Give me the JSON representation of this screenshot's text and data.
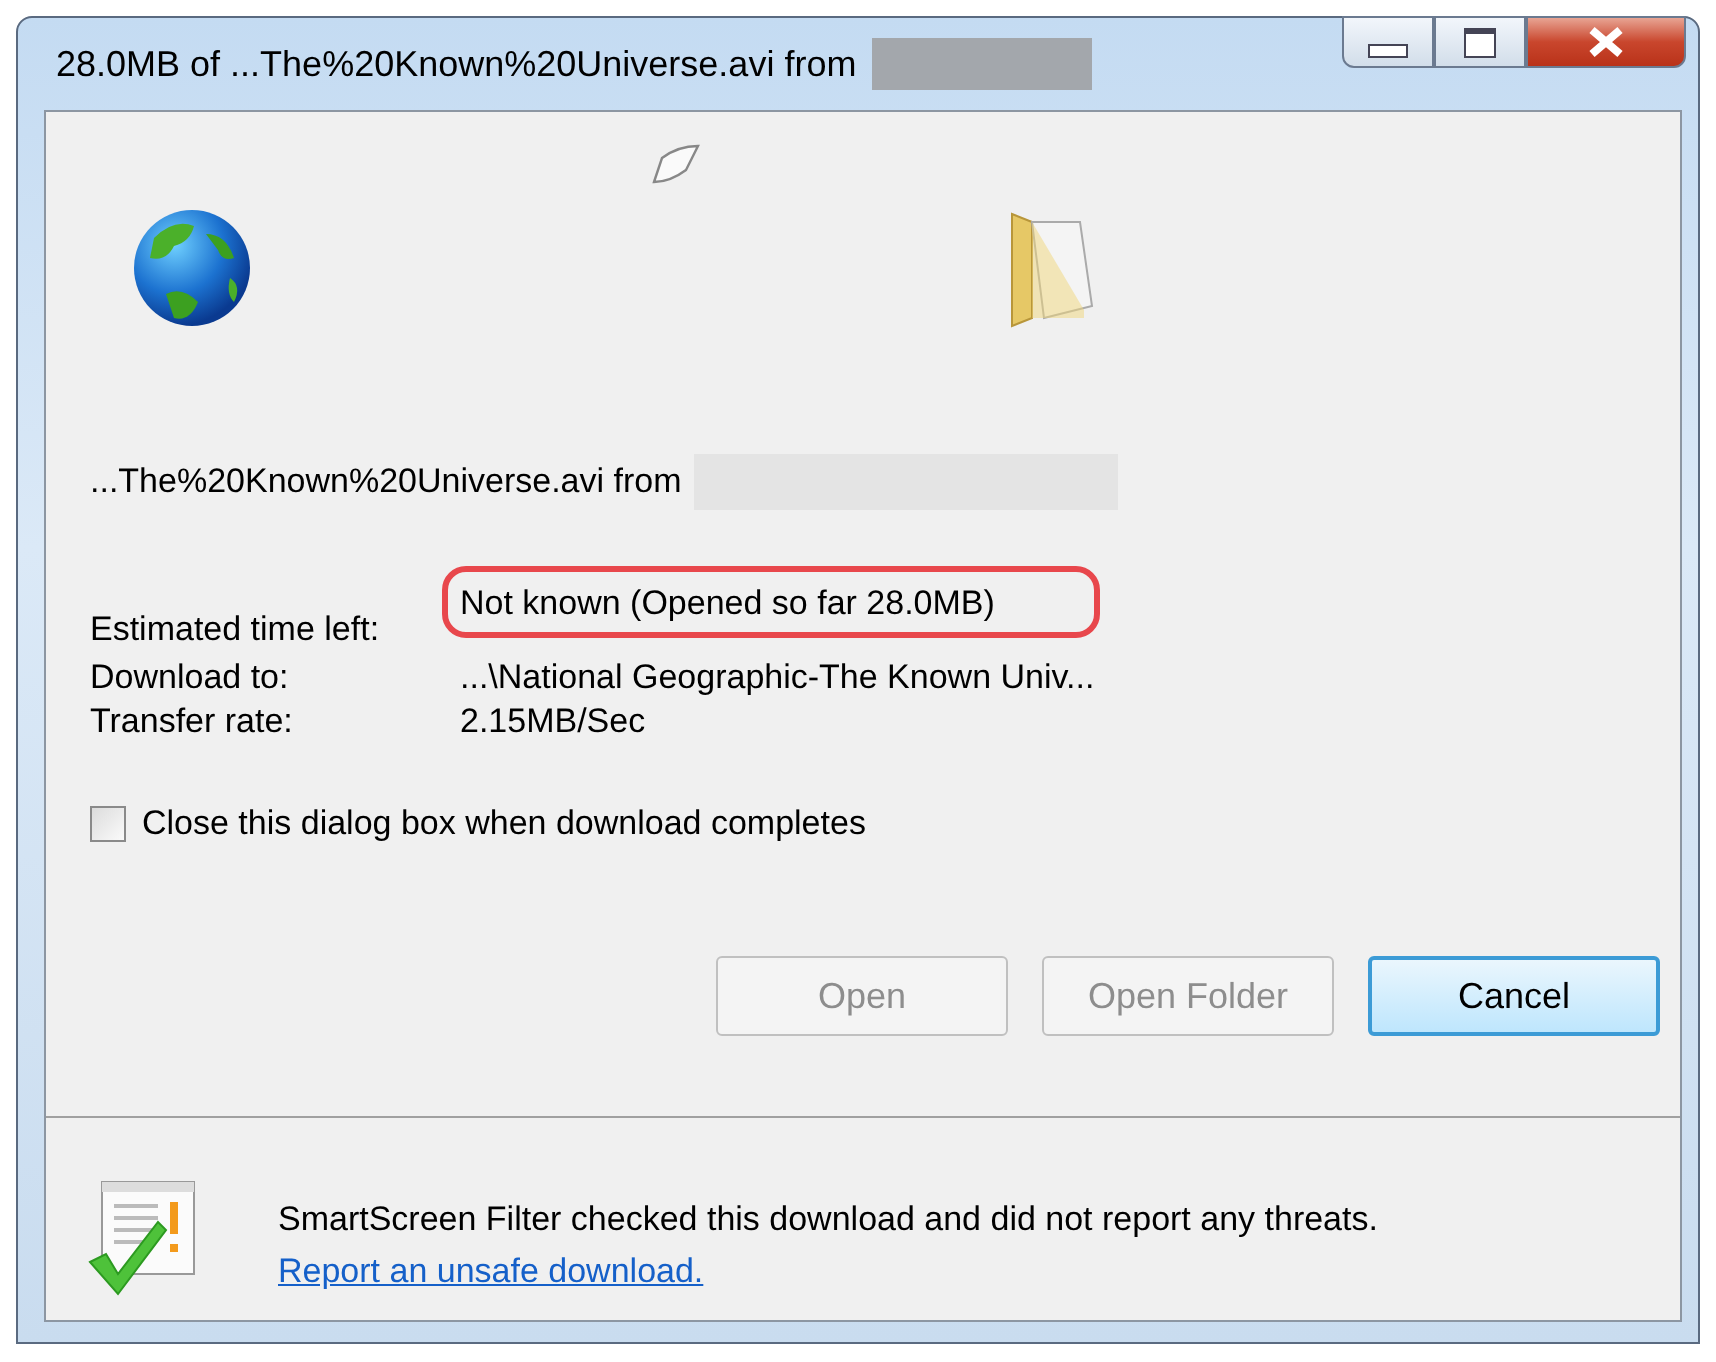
{
  "window": {
    "title": "28.0MB of ...The%20Known%20Universe.avi from"
  },
  "file_line": "...The%20Known%20Universe.avi from",
  "details": [
    {
      "label": "Estimated time left:",
      "value": "Not known (Opened so far 28.0MB)",
      "highlighted": true
    },
    {
      "label": "Download to:",
      "value": "...\\National Geographic-The Known Univ...",
      "highlighted": false
    },
    {
      "label": "Transfer rate:",
      "value": "2.15MB/Sec",
      "highlighted": false
    }
  ],
  "close_when_done": {
    "label": "Close this dialog box when download completes",
    "checked": false
  },
  "buttons": [
    {
      "label": "Open",
      "disabled": true,
      "default": false
    },
    {
      "label": "Open Folder",
      "disabled": true,
      "default": false
    },
    {
      "label": "Cancel",
      "disabled": false,
      "default": true
    }
  ],
  "smartscreen": {
    "message": "SmartScreen Filter checked this download and did not report any threats.",
    "link": "Report an unsafe download."
  }
}
